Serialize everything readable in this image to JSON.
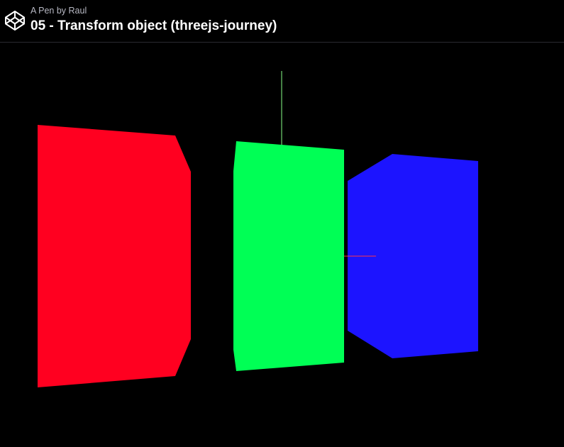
{
  "header": {
    "byline_prefix": "A Pen by",
    "author": "Raul",
    "title": "05 - Transform object (threejs-journey)",
    "logo_icon": "codepen-icon"
  },
  "scene": {
    "background_color": "#000000",
    "cubes": [
      {
        "name": "red-cube",
        "color": "#ff0020"
      },
      {
        "name": "green-cube",
        "color": "#00ff55"
      },
      {
        "name": "blue-cube",
        "color": "#1c14ff"
      }
    ],
    "axes_colors": {
      "x": "#ff3344",
      "y": "#88ff88"
    }
  }
}
